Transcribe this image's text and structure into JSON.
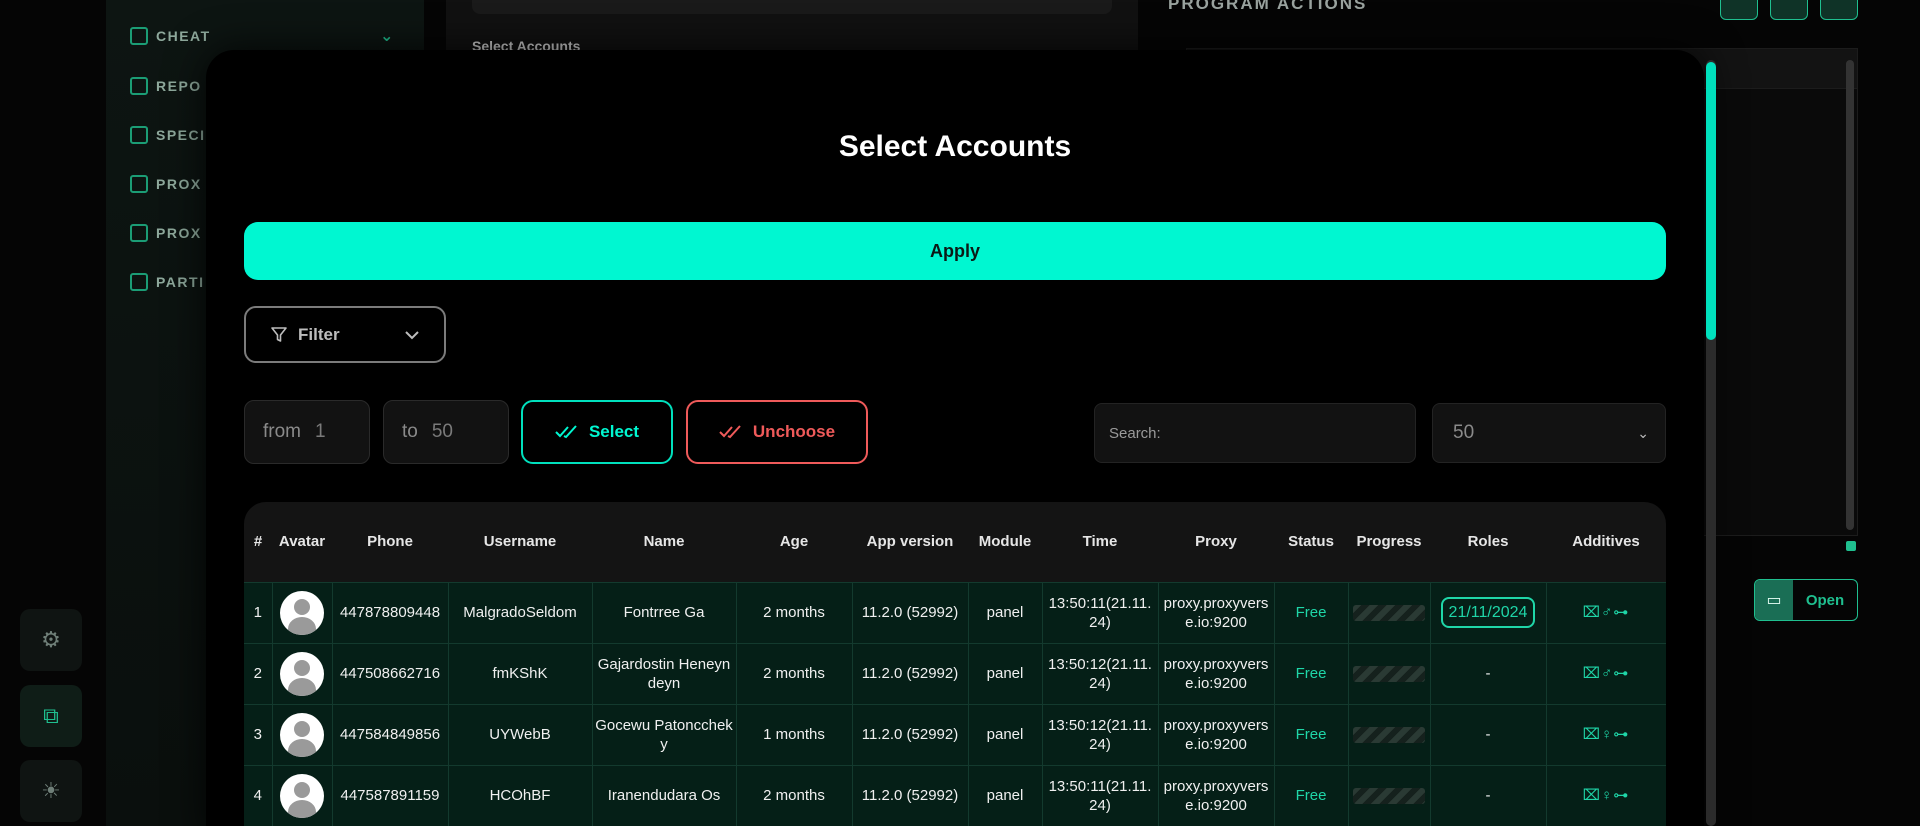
{
  "sidebar": {
    "items": [
      {
        "label": "CHEAT"
      },
      {
        "label": "REPO"
      },
      {
        "label": "SPECI"
      },
      {
        "label": "PROX"
      },
      {
        "label": "PROX"
      },
      {
        "label": "PARTI"
      }
    ]
  },
  "background": {
    "select_accounts_label": "Select Accounts",
    "program_actions_title": "PROGRAM ACTIONS",
    "open_label": "Open"
  },
  "modal": {
    "title": "Select Accounts",
    "apply_label": "Apply",
    "filter_label": "Filter",
    "range": {
      "from_label": "from",
      "from_value": "1",
      "to_label": "to",
      "to_value": "50"
    },
    "select_label": "Select",
    "unchoose_label": "Unchoose",
    "search_placeholder": "Search:",
    "page_size": "50"
  },
  "table": {
    "headers": [
      "#",
      "Avatar",
      "Phone",
      "Username",
      "Name",
      "Age",
      "App version",
      "Module",
      "Time",
      "Proxy",
      "Status",
      "Progress",
      "Roles",
      "Additives"
    ],
    "rows": [
      {
        "num": "1",
        "phone": "447878809448",
        "username": "MalgradoSeldom",
        "name": "Fontrree Ga",
        "age": "2 months",
        "app_version": "11.2.0 (52992)",
        "module": "panel",
        "time": "13:50:11(21.11.24)",
        "proxy": "proxy.proxyverse.io:9200",
        "status": "Free",
        "roles": "21/11/2024",
        "additives": "⌧♂⊶"
      },
      {
        "num": "2",
        "phone": "447508662716",
        "username": "fmKShK",
        "name": "Gajardostin Heneyndeyn",
        "age": "2 months",
        "app_version": "11.2.0 (52992)",
        "module": "panel",
        "time": "13:50:12(21.11.24)",
        "proxy": "proxy.proxyverse.io:9200",
        "status": "Free",
        "roles": "-",
        "additives": "⌧♂⊶"
      },
      {
        "num": "3",
        "phone": "447584849856",
        "username": "UYWebB",
        "name": "Gocewu Patonccheky",
        "age": "1 months",
        "app_version": "11.2.0 (52992)",
        "module": "panel",
        "time": "13:50:12(21.11.24)",
        "proxy": "proxy.proxyverse.io:9200",
        "status": "Free",
        "roles": "-",
        "additives": "⌧♀⊶"
      },
      {
        "num": "4",
        "phone": "447587891159",
        "username": "HCOhBF",
        "name": "Iranendudara Os",
        "age": "2 months",
        "app_version": "11.2.0 (52992)",
        "module": "panel",
        "time": "13:50:11(21.11.24)",
        "proxy": "proxy.proxyverse.io:9200",
        "status": "Free",
        "roles": "-",
        "additives": "⌧♀⊶"
      }
    ]
  }
}
